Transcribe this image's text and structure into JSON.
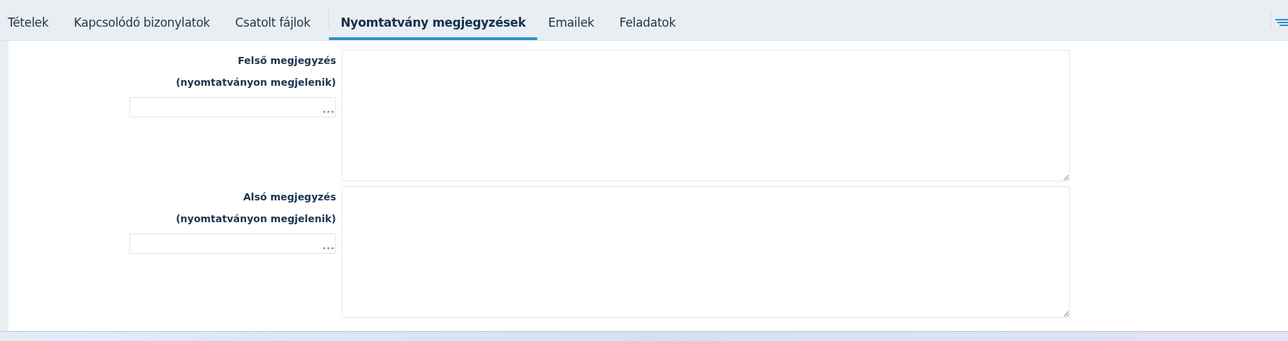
{
  "tabs": [
    {
      "label": "Tételek",
      "selected": false
    },
    {
      "label": "Kapcsolódó bizonylatok",
      "selected": false
    },
    {
      "label": "Csatolt fájlok",
      "selected": false
    },
    {
      "label": "Nyomtatvány megjegyzések",
      "selected": true
    },
    {
      "label": "Emailek",
      "selected": false
    },
    {
      "label": "Feladatok",
      "selected": false
    }
  ],
  "notes": [
    {
      "label": "Felső megjegyzés",
      "sublabel": "(nyomtatványon megjelenik)"
    },
    {
      "label": "Alsó megjegyzés",
      "sublabel": "(nyomtatványon megjelenik)"
    }
  ]
}
